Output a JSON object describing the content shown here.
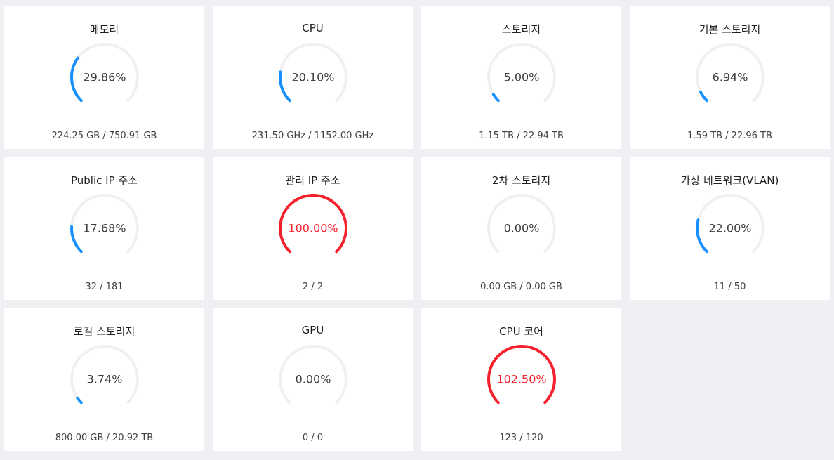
{
  "colors": {
    "background": "#eef0f4",
    "card": "#ffffff",
    "track": "#f0f0f0",
    "normal": "#1890ff",
    "over_limit": "#f5222d"
  },
  "cards": [
    {
      "title": "메모리",
      "percent_label": "29.86%",
      "percent": 29.86,
      "detail": "224.25 GB / 750.91 GB"
    },
    {
      "title": "CPU",
      "percent_label": "20.10%",
      "percent": 20.1,
      "detail": "231.50 GHz / 1152.00 GHz"
    },
    {
      "title": "스토리지",
      "percent_label": "5.00%",
      "percent": 5.0,
      "detail": "1.15 TB / 22.94 TB"
    },
    {
      "title": "기본 스토리지",
      "percent_label": "6.94%",
      "percent": 6.94,
      "detail": "1.59 TB / 22.96 TB"
    },
    {
      "title": "Public IP 주소",
      "percent_label": "17.68%",
      "percent": 17.68,
      "detail": "32 / 181"
    },
    {
      "title": "관리 IP 주소",
      "percent_label": "100.00%",
      "percent": 100.0,
      "detail": "2 / 2"
    },
    {
      "title": "2차 스토리지",
      "percent_label": "0.00%",
      "percent": 0.0,
      "detail": "0.00 GB / 0.00 GB"
    },
    {
      "title": "가상 네트워크(VLAN)",
      "percent_label": "22.00%",
      "percent": 22.0,
      "detail": "11 / 50"
    },
    {
      "title": "로컬 스토리지",
      "percent_label": "3.74%",
      "percent": 3.74,
      "detail": "800.00 GB / 20.92 TB"
    },
    {
      "title": "GPU",
      "percent_label": "0.00%",
      "percent": 0.0,
      "detail": "0 / 0"
    },
    {
      "title": "CPU 코어",
      "percent_label": "102.50%",
      "percent": 102.5,
      "detail": "123 / 120"
    }
  ]
}
